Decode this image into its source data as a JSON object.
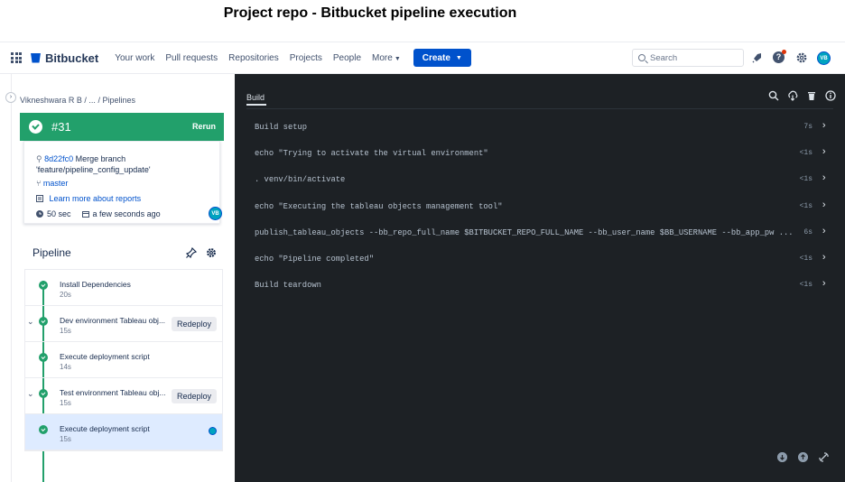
{
  "caption": "Project repo - Bitbucket pipeline execution",
  "header": {
    "brand": "Bitbucket",
    "nav": [
      "Your work",
      "Pull requests",
      "Repositories",
      "Projects",
      "People"
    ],
    "more_label": "More",
    "create_label": "Create",
    "search_placeholder": "Search",
    "avatar_initials": "VB"
  },
  "breadcrumb": {
    "user": "Vikneshwara R B",
    "sep1": "/",
    "ellipsis": "...",
    "sep2": "/",
    "current": "Pipelines"
  },
  "build": {
    "number": "#31",
    "status_color": "#22a06b",
    "rerun_label": "Rerun",
    "commit_hash": "8d22fc0",
    "commit_message": "Merge branch 'feature/pipeline_config_update'",
    "branch": "master",
    "reports_link": "Learn more about reports",
    "duration": "50 sec",
    "when": "a few seconds ago",
    "avatar_initials": "VB"
  },
  "pipeline": {
    "title": "Pipeline",
    "steps": [
      {
        "name": "Install Dependencies",
        "time": "20s"
      },
      {
        "name": "Dev environment Tableau obj...",
        "time": "15s",
        "action": "Redeploy"
      },
      {
        "name": "Execute deployment script",
        "time": "14s"
      },
      {
        "name": "Test environment Tableau obj...",
        "time": "15s",
        "action": "Redeploy"
      },
      {
        "name": "Execute deployment script",
        "time": "15s"
      }
    ]
  },
  "log": {
    "tab": "Build",
    "rows": [
      {
        "cmd": "Build setup",
        "time": "7s"
      },
      {
        "cmd": "echo \"Trying to activate the virtual environment\"",
        "time": "<1s"
      },
      {
        "cmd": ". venv/bin/activate",
        "time": "<1s"
      },
      {
        "cmd": "echo \"Executing the tableau objects management tool\"",
        "time": "<1s"
      },
      {
        "cmd": "publish_tableau_objects --bb_repo_full_name $BITBUCKET_REPO_FULL_NAME --bb_user_name $BB_USERNAME --bb_app_pw ...",
        "time": "6s"
      },
      {
        "cmd": "echo \"Pipeline completed\"",
        "time": "<1s"
      },
      {
        "cmd": "Build teardown",
        "time": "<1s"
      }
    ]
  }
}
